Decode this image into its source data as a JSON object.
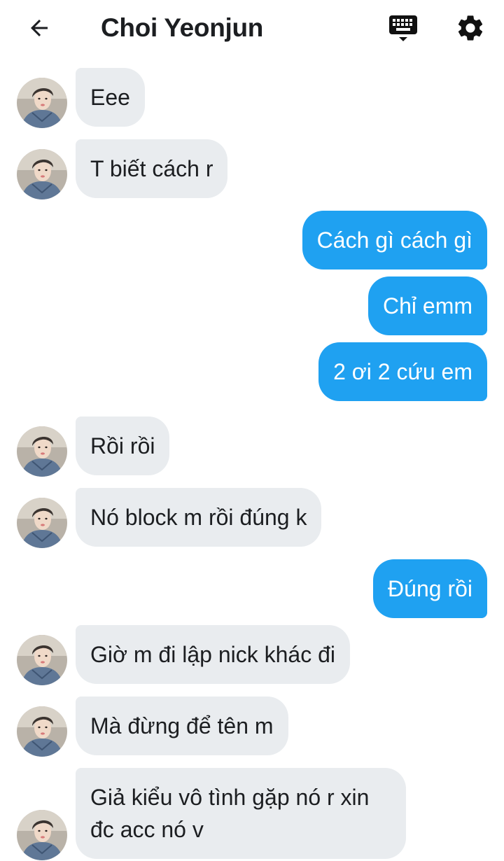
{
  "header": {
    "title": "Choi Yeonjun",
    "back_icon": "arrow-left-icon",
    "keyboard_icon": "keyboard-icon",
    "settings_icon": "gear-icon"
  },
  "colors": {
    "incoming_bubble": "#e9ecef",
    "outgoing_bubble": "#1fa1f1",
    "text_dark": "#1c1e21",
    "text_light": "#ffffff"
  },
  "messages": [
    {
      "direction": "incoming",
      "text": "Eee"
    },
    {
      "direction": "incoming",
      "text": "T biết cách r"
    },
    {
      "direction": "outgoing",
      "text": "Cách gì cách gì"
    },
    {
      "direction": "outgoing",
      "text": "Chỉ emm"
    },
    {
      "direction": "outgoing",
      "text": "2 ơi 2 cứu em"
    },
    {
      "direction": "incoming",
      "text": "Rồi rồi"
    },
    {
      "direction": "incoming",
      "text": "Nó block m rồi đúng k"
    },
    {
      "direction": "outgoing",
      "text": "Đúng rồi"
    },
    {
      "direction": "incoming",
      "text": "Giờ m đi lập nick khác đi"
    },
    {
      "direction": "incoming",
      "text": "Mà đừng để tên m"
    },
    {
      "direction": "incoming",
      "text": "Giả kiểu vô tình gặp nó r xin đc acc nó v"
    }
  ]
}
